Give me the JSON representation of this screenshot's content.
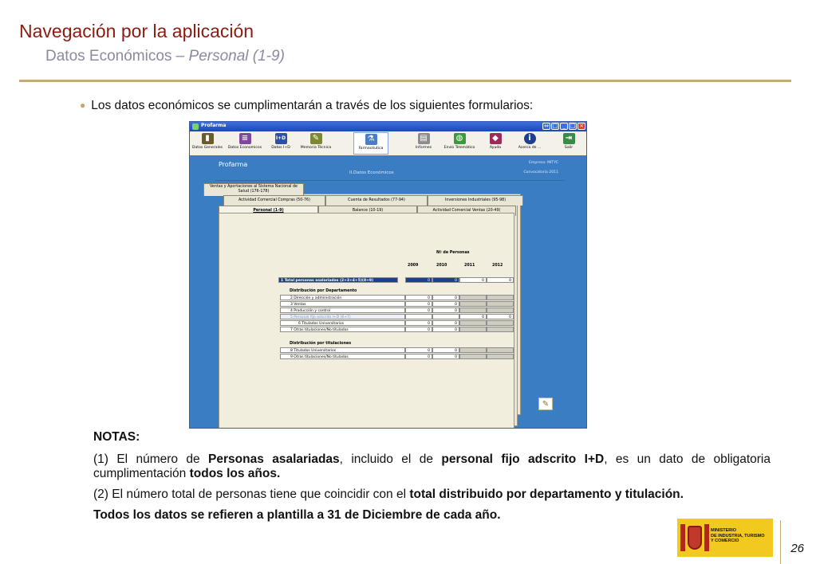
{
  "slide": {
    "title": "Navegación por la aplicación",
    "subtitle_prefix": "Datos Económicos – ",
    "subtitle_italic": "Personal (1-9)",
    "bullet": "Los datos económicos se cumplimentarán a través de los siguientes formularios:",
    "page_number": "26"
  },
  "app": {
    "window_title": "Profarma",
    "window_buttons": [
      "⇔",
      "□",
      "_",
      "□",
      "×"
    ],
    "toolbar": [
      {
        "label": "Datos Generales",
        "icon": "bar-chart-icon",
        "color": "#6b5a2a"
      },
      {
        "label": "Datos Economicos",
        "icon": "ledger-icon",
        "color": "#7b4a9c"
      },
      {
        "label": "Datos I+D",
        "icon": "rd-icon",
        "color": "#2c4fa8"
      },
      {
        "label": "Memoria Técnica",
        "icon": "pencil-icon",
        "color": "#7a8a2c"
      },
      {
        "label": "Farmacéutica",
        "icon": "pharma-icon",
        "color": "#4a7dc4"
      },
      {
        "label": "Informes",
        "icon": "report-icon",
        "color": "#8c8c8c"
      },
      {
        "label": "Envío Telemático",
        "icon": "globe-icon",
        "color": "#3b9a3b"
      },
      {
        "label": "Ayuda",
        "icon": "help-book-icon",
        "color": "#9c2a5a"
      },
      {
        "label": "Acerca de ...",
        "icon": "info-icon",
        "color": "#1e3f8f"
      },
      {
        "label": "Salir",
        "icon": "exit-icon",
        "color": "#3a8a4a"
      }
    ],
    "banner": {
      "name": "Profarma",
      "section": "II.Datos Económicos",
      "empresa": "Empresa: MITYC",
      "convocatoria": "Convocatoria 2011"
    },
    "tabs_row1": [
      "Ventas y Aportaciones al Sistema Nacional de Salud (176-178)"
    ],
    "tabs_row2": [
      "Actividad Comercial Compras (50-76)",
      "Cuenta de Resultados (77-94)",
      "Inversiones Industriales (95-98)"
    ],
    "tabs_row3": [
      "Personal (1-9)",
      "Balance (10-19)",
      "Actividad Comercial Ventas (20-49)"
    ],
    "table": {
      "group_header": "Nº de Personas",
      "years": [
        "2009",
        "2010",
        "2011",
        "2012"
      ],
      "total_row": {
        "label": "1 Total personas asalariadas (2+3+4+5)(8+9)",
        "values": [
          "0",
          "0",
          "0",
          "0"
        ]
      },
      "section1": "Distribución por Departamento",
      "rows1": [
        {
          "label": "2 Dirección y administración",
          "values": [
            "0",
            "0",
            "",
            ""
          ]
        },
        {
          "label": "3 Ventas",
          "values": [
            "0",
            "0",
            "",
            ""
          ]
        },
        {
          "label": "4 Producción y control",
          "values": [
            "0",
            "0",
            "",
            ""
          ]
        },
        {
          "label": "5 Personal fijo adscrito I+D (6+7)",
          "values": [
            "",
            "",
            "0",
            "0"
          ]
        },
        {
          "label": "6 Titulados Universitarios",
          "values": [
            "0",
            "0",
            "",
            ""
          ]
        },
        {
          "label": "7 Otras titulaciones/No titulados",
          "values": [
            "0",
            "0",
            "",
            ""
          ]
        }
      ],
      "section2": "Distribución por titulaciones",
      "rows2": [
        {
          "label": "8 Titulados Universitarios",
          "values": [
            "0",
            "0",
            "",
            ""
          ]
        },
        {
          "label": "9 Otras titulaciones/No titulados",
          "values": [
            "0",
            "0",
            "",
            ""
          ]
        }
      ]
    }
  },
  "notes": {
    "heading": "NOTAS:",
    "n1_a": "(1) El número de ",
    "n1_b": "Personas asalariadas",
    "n1_c": ", incluido el de ",
    "n1_d": "personal fijo adscrito I+D",
    "n1_e": ",  es un dato de obligatoria cumplimentación ",
    "n1_f": "todos los años.",
    "n2_a": "(2) El número total de personas tiene que coincidir con el ",
    "n2_b": "total distribuido por departamento y titulación.",
    "n3": "Todos los datos se refieren a plantilla a 31 de Diciembre de cada año."
  },
  "logo": {
    "line1": "MINISTERIO",
    "line2": "DE INDUSTRIA, TURISMO",
    "line3": "Y COMERCIO"
  }
}
